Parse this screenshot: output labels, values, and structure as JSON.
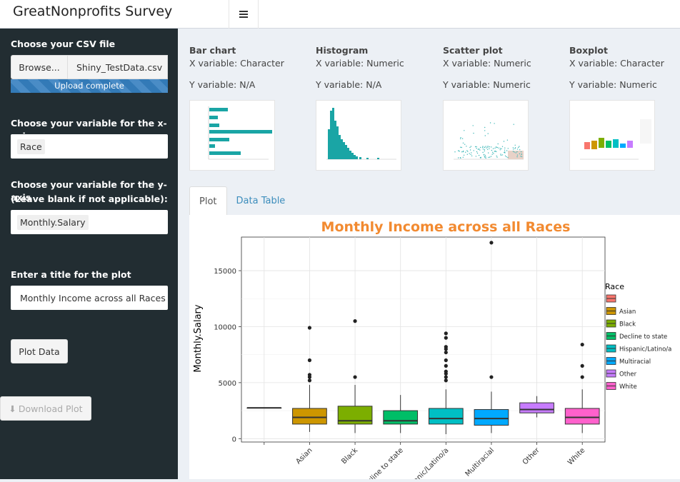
{
  "app": {
    "title": "GreatNonprofits Survey Analytics"
  },
  "sidebar": {
    "csv_label": "Choose your CSV file",
    "browse_label": "Browse...",
    "file_name": "Shiny_TestData.csv",
    "upload_status": "Upload complete",
    "x_label": "Choose your variable for the x-axis:",
    "x_value": "Race",
    "y_label_line1": "Choose your variable for the y-axis",
    "y_label_line2": "(Leave blank if not applicable):",
    "y_value": "Monthly.Salary",
    "title_label": "Enter a title for the plot",
    "title_value": "Monthly Income across all Races",
    "plot_button": "Plot Data",
    "download_button": "Download Plot"
  },
  "chart_types": [
    {
      "name": "Bar chart",
      "x": "X variable: Character",
      "y": "Y variable: N/A"
    },
    {
      "name": "Histogram",
      "x": "X variable: Numeric",
      "y": "Y variable: N/A"
    },
    {
      "name": "Scatter plot",
      "x": "X variable: Numeric",
      "y": "Y variable: Numeric"
    },
    {
      "name": "Boxplot",
      "x": "X variable: Character",
      "y": "Y variable: Numeric"
    }
  ],
  "tabs": [
    {
      "label": "Plot",
      "active": true
    },
    {
      "label": "Data Table",
      "active": false
    }
  ],
  "chart_data": {
    "type": "boxplot",
    "title": "Monthly Income across all Races",
    "ylabel": "Monthly.Salary",
    "xlabel": "",
    "legend_title": "Race",
    "legend_position": "right",
    "ylim": [
      -300,
      18000
    ],
    "yticks": [
      0,
      5000,
      10000,
      15000
    ],
    "ytick_labels": [
      "0",
      "5000",
      "10000",
      "15000"
    ],
    "grid": true,
    "title_color": "#f28a30",
    "categories": [
      "",
      "Asian",
      "Black",
      "Decline to state",
      "Hispanic/Latino/a",
      "Multiracial",
      "Other",
      "White"
    ],
    "boxes": [
      {
        "name": "",
        "color": "#f8766d",
        "min": 2750,
        "q1": 2750,
        "median": 2750,
        "q3": 2750,
        "max": 2750,
        "outliers": []
      },
      {
        "name": "Asian",
        "color": "#cd9600",
        "min": 600,
        "q1": 1300,
        "median": 1900,
        "q3": 2700,
        "max": 4800,
        "outliers": [
          5200,
          5500,
          5700,
          7000,
          9900
        ]
      },
      {
        "name": "Black",
        "color": "#7cae00",
        "min": 500,
        "q1": 1300,
        "median": 1600,
        "q3": 2900,
        "max": 4800,
        "outliers": [
          5500,
          10500
        ]
      },
      {
        "name": "Decline to state",
        "color": "#00be67",
        "min": 500,
        "q1": 1300,
        "median": 1600,
        "q3": 2500,
        "max": 3900,
        "outliers": []
      },
      {
        "name": "Hispanic/Latino/a",
        "color": "#00bfc4",
        "min": 400,
        "q1": 1300,
        "median": 1800,
        "q3": 2700,
        "max": 4400,
        "outliers": [
          5200,
          5500,
          5800,
          6000,
          6500,
          7000,
          7700,
          8000,
          8200,
          9000,
          9400
        ]
      },
      {
        "name": "Multiracial",
        "color": "#00a9ff",
        "min": 500,
        "q1": 1200,
        "median": 1800,
        "q3": 2600,
        "max": 4200,
        "outliers": [
          5500,
          17500
        ]
      },
      {
        "name": "Other",
        "color": "#c77cff",
        "min": 1900,
        "q1": 2300,
        "median": 2600,
        "q3": 3200,
        "max": 3800,
        "outliers": []
      },
      {
        "name": "White",
        "color": "#ff61cc",
        "min": 500,
        "q1": 1300,
        "median": 1900,
        "q3": 2700,
        "max": 4400,
        "outliers": [
          5500,
          6500,
          8400
        ]
      }
    ]
  }
}
